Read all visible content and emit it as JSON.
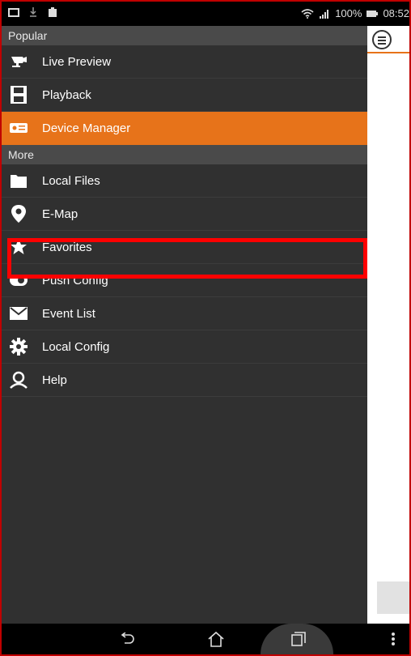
{
  "status_bar": {
    "battery_percent": "100%",
    "time": "08:52"
  },
  "sections": {
    "popular": "Popular",
    "more": "More"
  },
  "popular_items": [
    {
      "label": "Live Preview",
      "icon": "camera-icon"
    },
    {
      "label": "Playback",
      "icon": "film-icon"
    },
    {
      "label": "Device Manager",
      "icon": "dvr-icon",
      "active": true
    }
  ],
  "more_items": [
    {
      "label": "Local Files",
      "icon": "folder-icon"
    },
    {
      "label": "E-Map",
      "icon": "map-pin-icon"
    },
    {
      "label": "Favorites",
      "icon": "star-icon"
    },
    {
      "label": "Push Config",
      "icon": "toggle-icon"
    },
    {
      "label": "Event List",
      "icon": "envelope-icon"
    },
    {
      "label": "Local Config",
      "icon": "gear-icon"
    },
    {
      "label": "Help",
      "icon": "person-icon"
    }
  ],
  "colors": {
    "accent": "#e7731a",
    "highlight": "#ff0000",
    "drawer_bg": "#303030"
  }
}
